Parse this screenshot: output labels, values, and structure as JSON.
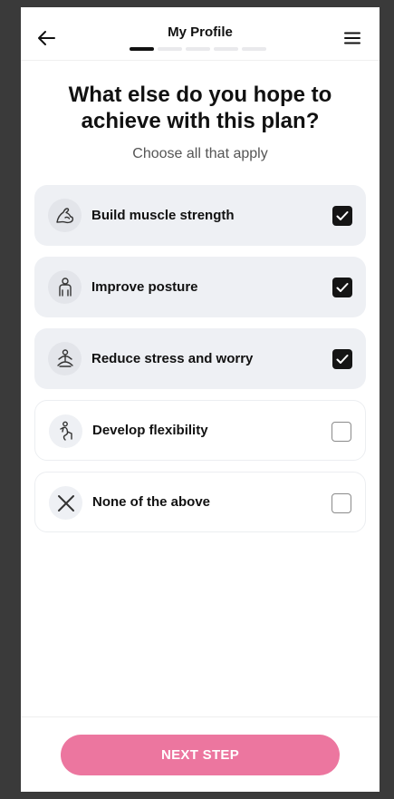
{
  "header": {
    "title": "My Profile",
    "back_icon": "arrow-left-icon",
    "menu_icon": "hamburger-menu-icon",
    "progress": {
      "current_step": 1,
      "total_steps": 5
    }
  },
  "question": {
    "title": "What else do you hope to achieve with this plan?",
    "subtitle": "Choose all that apply"
  },
  "options": [
    {
      "label": "Build muscle strength",
      "icon": "flexed-arm-icon",
      "selected": true
    },
    {
      "label": "Improve posture",
      "icon": "person-posture-icon",
      "selected": true
    },
    {
      "label": "Reduce stress and worry",
      "icon": "meditation-icon",
      "selected": true
    },
    {
      "label": "Develop flexibility",
      "icon": "stretching-person-icon",
      "selected": false
    },
    {
      "label": "None of the above",
      "icon": "close-x-icon",
      "selected": false
    }
  ],
  "footer": {
    "next_label": "NEXT STEP"
  },
  "colors": {
    "accent": "#ec769f",
    "selected_bg": "#eef0f4",
    "check": "#151515"
  }
}
